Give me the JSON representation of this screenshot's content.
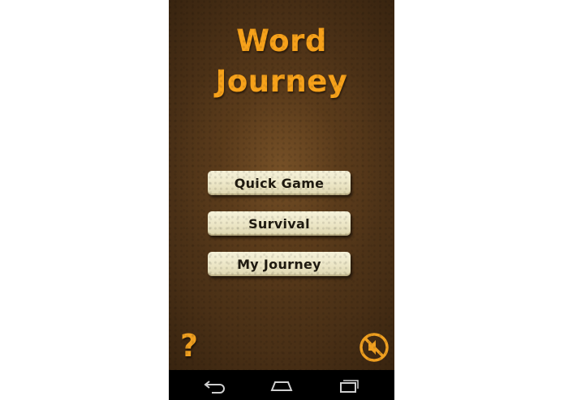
{
  "game": {
    "title_line1": "Word",
    "title_line2": "Journey",
    "menu": {
      "quick_game": "Quick Game",
      "survival": "Survival",
      "my_journey": "My Journey"
    },
    "help_glyph": "?",
    "icons": {
      "help": "question-mark-icon",
      "sound": "sound-muted-icon"
    },
    "colors": {
      "title": "#f7a21b",
      "button_face": "#ece6c6",
      "background": "#4a3016"
    }
  },
  "nav_bar": {
    "icons": [
      "back-icon",
      "home-icon",
      "recent-apps-icon"
    ]
  }
}
